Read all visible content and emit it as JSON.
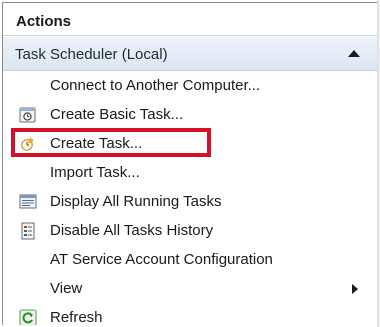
{
  "panel": {
    "title": "Actions"
  },
  "section": {
    "label": "Task Scheduler (Local)",
    "collapse_icon": "triangle-up-icon"
  },
  "items": [
    {
      "label": "Connect to Another Computer...",
      "icon": ""
    },
    {
      "label": "Create Basic Task...",
      "icon": "basic-task-wizard-icon"
    },
    {
      "label": "Create Task...",
      "icon": "create-task-icon"
    },
    {
      "label": "Import Task...",
      "icon": ""
    },
    {
      "label": "Display All Running Tasks",
      "icon": "running-tasks-icon"
    },
    {
      "label": "Disable All Tasks History",
      "icon": "tasks-history-icon"
    },
    {
      "label": "AT Service Account Configuration",
      "icon": ""
    },
    {
      "label": "View",
      "icon": "",
      "submenu": true
    },
    {
      "label": "Refresh",
      "icon": "refresh-icon"
    }
  ],
  "colors": {
    "highlight": "#d3122a",
    "section_bg": "#dbe6f3"
  }
}
